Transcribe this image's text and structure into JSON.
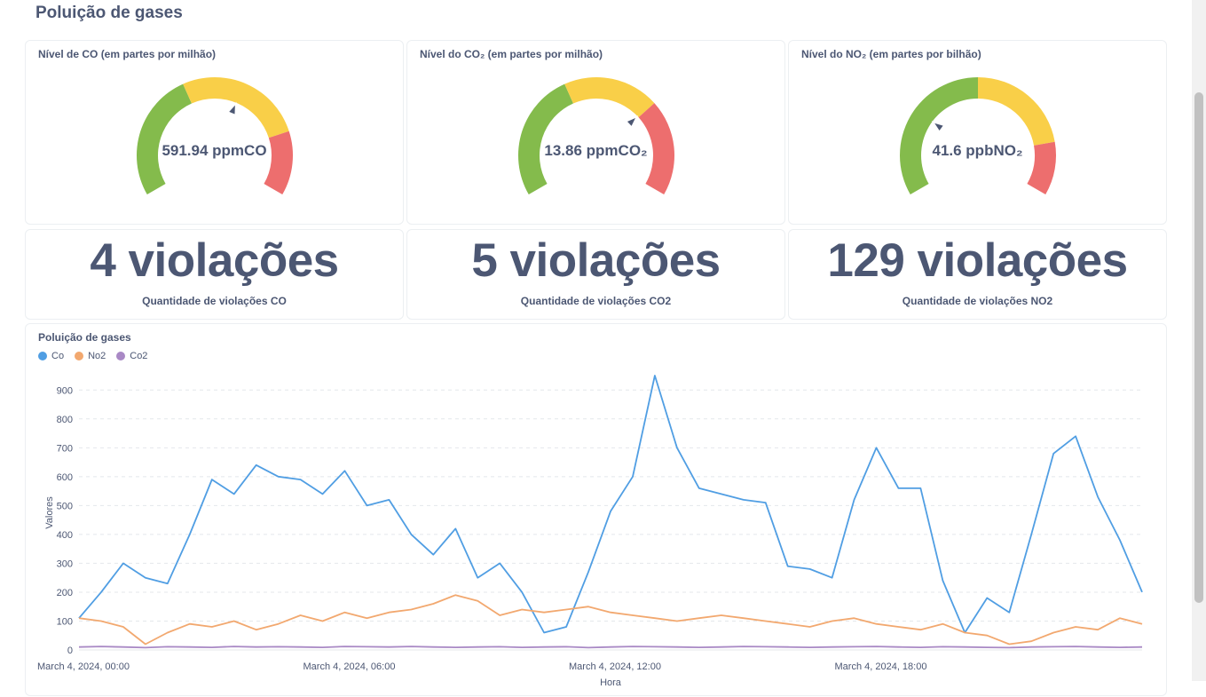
{
  "page": {
    "title": "Poluição de gases"
  },
  "colors": {
    "green": "#84bb4c",
    "yellow": "#f9cf48",
    "red": "#ed6e6e",
    "text": "#4c5773",
    "co": "#509ee3",
    "no2": "#f2a86f",
    "co2": "#a989c5"
  },
  "gauges": [
    {
      "title": "Nível de CO (em partes por milhão)",
      "value_label": "591.94 ppmCO",
      "value": 591.94,
      "min": 0,
      "max": 1000,
      "segments": [
        {
          "min": 0,
          "max": 400,
          "color": "#84bb4c"
        },
        {
          "min": 400,
          "max": 800,
          "color": "#f9cf48"
        },
        {
          "min": 800,
          "max": 1000,
          "color": "#ed6e6e"
        }
      ]
    },
    {
      "title": "Nível do CO₂ (em partes por milhão)",
      "value_label": "13.86 ppmCO₂",
      "value": 13.86,
      "min": 0,
      "max": 20,
      "segments": [
        {
          "min": 0,
          "max": 8,
          "color": "#84bb4c"
        },
        {
          "min": 8,
          "max": 14,
          "color": "#f9cf48"
        },
        {
          "min": 14,
          "max": 20,
          "color": "#ed6e6e"
        }
      ]
    },
    {
      "title": "Nível do NO₂ (em partes por bilhão)",
      "value_label": "41.6 ppbNO₂",
      "value": 41.6,
      "min": 0,
      "max": 150,
      "segments": [
        {
          "min": 0,
          "max": 75,
          "color": "#84bb4c"
        },
        {
          "min": 75,
          "max": 125,
          "color": "#f9cf48"
        },
        {
          "min": 125,
          "max": 150,
          "color": "#ed6e6e"
        }
      ]
    }
  ],
  "violations": [
    {
      "number": "4 violações",
      "label": "Quantidade de violações CO"
    },
    {
      "number": "5 violações",
      "label": "Quantidade de violações CO2"
    },
    {
      "number": "129 violações",
      "label": "Quantidade de violações NO2"
    }
  ],
  "chart": {
    "title": "Poluição de gases",
    "legend": [
      {
        "name": "Co",
        "color": "#509ee3"
      },
      {
        "name": "No2",
        "color": "#f2a86f"
      },
      {
        "name": "Co2",
        "color": "#a989c5"
      }
    ]
  },
  "chart_data": {
    "type": "line",
    "title": "Poluição de gases",
    "xlabel": "Hora",
    "ylabel": "Valores",
    "ylim": [
      0,
      950
    ],
    "y_ticks": [
      0,
      100,
      200,
      300,
      400,
      500,
      600,
      700,
      800,
      900
    ],
    "x_tick_labels": [
      "March 4, 2024, 00:00",
      "March 4, 2024, 06:00",
      "March 4, 2024, 12:00",
      "March 4, 2024, 18:00"
    ],
    "x_range_hours": [
      0,
      24
    ],
    "grid": true,
    "legend_position": "top-left",
    "series": [
      {
        "name": "Co",
        "color": "#509ee3",
        "x": [
          0,
          0.5,
          1,
          1.5,
          2,
          2.5,
          3,
          3.5,
          4,
          4.5,
          5,
          5.5,
          6,
          6.5,
          7,
          7.5,
          8,
          8.5,
          9,
          9.5,
          10,
          10.5,
          11,
          11.5,
          12,
          12.5,
          13,
          13.5,
          14,
          14.5,
          15,
          15.5,
          16,
          16.5,
          17,
          17.5,
          18,
          18.5,
          19,
          19.5,
          20,
          20.5,
          21,
          21.5,
          22,
          22.5,
          23,
          23.5,
          24
        ],
        "values": [
          110,
          200,
          300,
          250,
          230,
          400,
          590,
          540,
          640,
          600,
          590,
          540,
          620,
          500,
          520,
          400,
          330,
          420,
          250,
          300,
          200,
          60,
          80,
          270,
          480,
          600,
          950,
          700,
          560,
          540,
          520,
          510,
          290,
          280,
          250,
          520,
          700,
          560,
          560,
          240,
          60,
          180,
          130,
          400,
          680,
          740,
          530,
          380,
          200
        ]
      },
      {
        "name": "No2",
        "color": "#f2a86f",
        "x": [
          0,
          0.5,
          1,
          1.5,
          2,
          2.5,
          3,
          3.5,
          4,
          4.5,
          5,
          5.5,
          6,
          6.5,
          7,
          7.5,
          8,
          8.5,
          9,
          9.5,
          10,
          10.5,
          11,
          11.5,
          12,
          12.5,
          13,
          13.5,
          14,
          14.5,
          15,
          15.5,
          16,
          16.5,
          17,
          17.5,
          18,
          18.5,
          19,
          19.5,
          20,
          20.5,
          21,
          21.5,
          22,
          22.5,
          23,
          23.5,
          24
        ],
        "values": [
          110,
          100,
          80,
          20,
          60,
          90,
          80,
          100,
          70,
          90,
          120,
          100,
          130,
          110,
          130,
          140,
          160,
          190,
          170,
          120,
          140,
          130,
          140,
          150,
          130,
          120,
          110,
          100,
          110,
          120,
          110,
          100,
          90,
          80,
          100,
          110,
          90,
          80,
          70,
          90,
          60,
          50,
          20,
          30,
          60,
          80,
          70,
          110,
          90
        ]
      },
      {
        "name": "Co2",
        "color": "#a989c5",
        "x": [
          0,
          0.5,
          1,
          1.5,
          2,
          2.5,
          3,
          3.5,
          4,
          4.5,
          5,
          5.5,
          6,
          6.5,
          7,
          7.5,
          8,
          8.5,
          9,
          9.5,
          10,
          10.5,
          11,
          11.5,
          12,
          12.5,
          13,
          13.5,
          14,
          14.5,
          15,
          15.5,
          16,
          16.5,
          17,
          17.5,
          18,
          18.5,
          19,
          19.5,
          20,
          20.5,
          21,
          21.5,
          22,
          22.5,
          23,
          23.5,
          24
        ],
        "values": [
          10,
          12,
          10,
          8,
          11,
          10,
          9,
          12,
          10,
          11,
          10,
          9,
          12,
          11,
          10,
          12,
          10,
          9,
          10,
          11,
          9,
          10,
          11,
          8,
          10,
          12,
          11,
          10,
          9,
          10,
          12,
          11,
          10,
          9,
          10,
          11,
          12,
          10,
          9,
          11,
          10,
          9,
          8,
          10,
          11,
          12,
          10,
          9,
          10
        ]
      }
    ]
  }
}
